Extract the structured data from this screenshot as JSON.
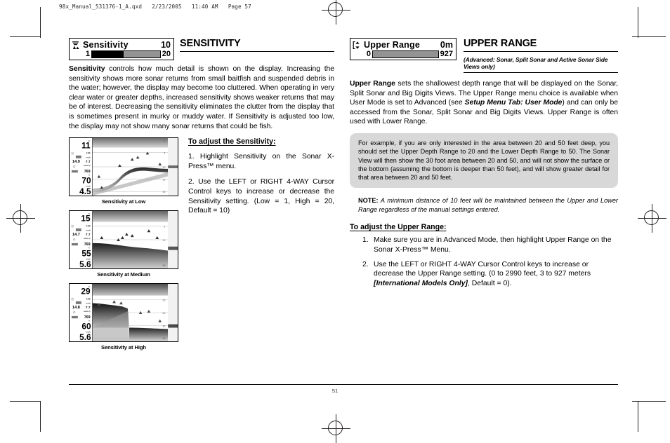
{
  "file_header": "98x_Manual_531376-1_A.qxd   2/23/2005   11:40 AM   Page 57",
  "page_number": "51",
  "left_column": {
    "menu_widget": {
      "icon": "sensitivity-icon",
      "title": "Sensitivity",
      "value": "10",
      "min": "1",
      "max": "20",
      "fill_percent": 47
    },
    "section_title": "SENSITIVITY",
    "lead_paragraph_bold": "Sensitivity",
    "lead_paragraph": " controls how much detail is shown on the display. Increasing the sensitivity shows more sonar returns from small baitfish and suspended debris in the water; however, the display may become too cluttered. When operating in very clear water or greater depths, increased sensitivity shows weaker returns that may be of interest. Decreasing the sensitivity eliminates the clutter from the display that is sometimes present in murky or muddy water. If Sensitivity is adjusted too low, the display may not show many sonar returns that could be fish.",
    "adjust_heading": "To adjust the Sensitivity:",
    "steps": [
      "1. Highlight Sensitivity on the Sonar X-Press™ menu.",
      "2. Use the LEFT or RIGHT 4-WAY Cursor Control keys to increase or decrease the Sensitivity setting. (Low = 1, High = 20, Default = 10)"
    ],
    "screenshots": [
      {
        "caption": "Sensitivity at Low",
        "depth": "11",
        "temp": "14.9",
        "speed": "7.7",
        "freq": "769",
        "big1": "70",
        "big2": "4.5",
        "label_ft": "ft",
        "label_mph": "mph",
        "label_nautmp": "nautmp",
        "label_sm": "sm",
        "top_scale": "0",
        "scale_marks": [
          "5",
          "10",
          "15",
          "30"
        ],
        "side_value": "156"
      },
      {
        "caption": "Sensitivity at Medium",
        "depth": "15",
        "temp": "14.7",
        "speed": "7.7",
        "freq": "769",
        "big1": "55",
        "big2": "5.6",
        "label_ft": "ft",
        "label_mph": "mph",
        "label_nautmp": "nautmp",
        "label_sm": "sm",
        "top_scale": "0",
        "scale_marks": [
          "5",
          "10",
          "15",
          "26"
        ],
        "side_value": "156"
      },
      {
        "caption": "Sensitivity at High",
        "depth": "29",
        "temp": "14.8",
        "speed": "7.7",
        "freq": "769",
        "big1": "60",
        "big2": "5.6",
        "label_ft": "ft",
        "label_mph": "mph",
        "label_nautmp": "nautmp",
        "label_sm": "sm",
        "top_scale": "0",
        "scale_marks": [
          "10",
          "20",
          "30",
          "40"
        ],
        "side_value": "156"
      }
    ]
  },
  "right_column": {
    "menu_widget": {
      "icon": "upper-range-icon",
      "title": "Upper Range",
      "value": "0m",
      "min": "0",
      "max": "927",
      "fill_percent": 0
    },
    "section_title": "UPPER RANGE",
    "section_subtitle": "(Advanced: Sonar, Split Sonar and Active Sonar Side Views only)",
    "lead_bold": "Upper Range",
    "lead_part1": " sets the shallowest depth range that will be displayed on the Sonar, Split Sonar and Big Digits Views. The Upper Range menu choice is available when User Mode is set to Advanced (see ",
    "lead_emph": "Setup Menu Tab: User Mode",
    "lead_part2": ") and can only be accessed from the Sonar, Split Sonar and Big Digits Views. Upper Range is often used with Lower Range.",
    "callout": "For example, if you are only interested in the area between 20 and 50 feet deep, you should set the Upper Depth Range to 20 and the Lower Depth Range to 50. The Sonar View will then show the 30 foot area between 20 and 50, and will not show the surface or the bottom (assuming the bottom is deeper than 50 feet), and will show greater detail for that area between 20 and 50 feet.",
    "note_label": "NOTE:",
    "note_text": " A minimum distance of 10 feet will be maintained between the Upper and Lower Range regardless of the manual settings entered.",
    "adjust_heading": "To adjust the Upper Range:",
    "steps": [
      {
        "num": "1.",
        "text": "Make sure you are in Advanced Mode, then highlight Upper Range on the Sonar X-Press™ Menu."
      },
      {
        "num": "2.",
        "text_part1": "Use the LEFT or RIGHT 4-WAY Cursor Control keys to increase or decrease the Upper Range setting. (0 to 2990 feet, 3 to 927 meters ",
        "text_emph": "[International Models Only]",
        "text_part2": ", Default = 0)."
      }
    ]
  },
  "colors": {
    "ink": "#000000",
    "callout_bg": "#d8d8d8",
    "bar_track": "#939393",
    "crop_mark": "#231f20"
  }
}
